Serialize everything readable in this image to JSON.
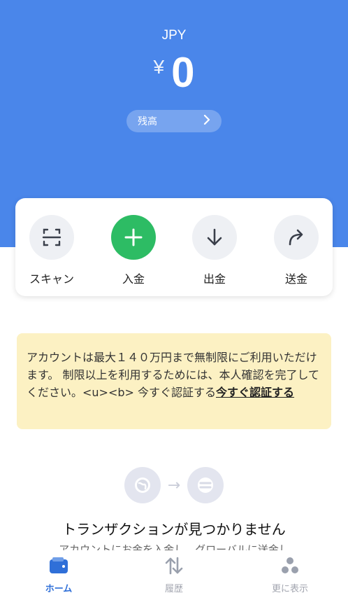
{
  "hero": {
    "currency": "JPY",
    "symbol": "¥",
    "amount": "0",
    "balance_label": "残高",
    "balance_chevron": "›"
  },
  "actions": [
    {
      "label": "スキャン",
      "icon": "scan-icon"
    },
    {
      "label": "入金",
      "icon": "plus-icon"
    },
    {
      "label": "出金",
      "icon": "arrow-down-icon"
    },
    {
      "label": "送金",
      "icon": "share-arrow-icon"
    }
  ],
  "notice": {
    "text": "アカウントは最大１４０万円まで無制限にご利用いただけます。 制限以上を利用するためには、本人確認を完了してください。<u><b> 今すぐ認証する",
    "link": "今すぐ認証する"
  },
  "empty": {
    "title": "トランザクションが見つかりません",
    "subtitle": "アカウントにお金を入金し、グローバルに送金し"
  },
  "tabs": [
    {
      "label": "ホーム",
      "icon": "wallet-icon",
      "active": true
    },
    {
      "label": "履歴",
      "icon": "transfer-arrows-icon",
      "active": false
    },
    {
      "label": "更に表示",
      "icon": "more-dots-icon",
      "active": false
    }
  ],
  "colors": {
    "hero": "#4a86ea",
    "deposit_green": "#2dbc64",
    "notice_bg": "#fcf1c3",
    "tab_active": "#2f6fd8"
  }
}
